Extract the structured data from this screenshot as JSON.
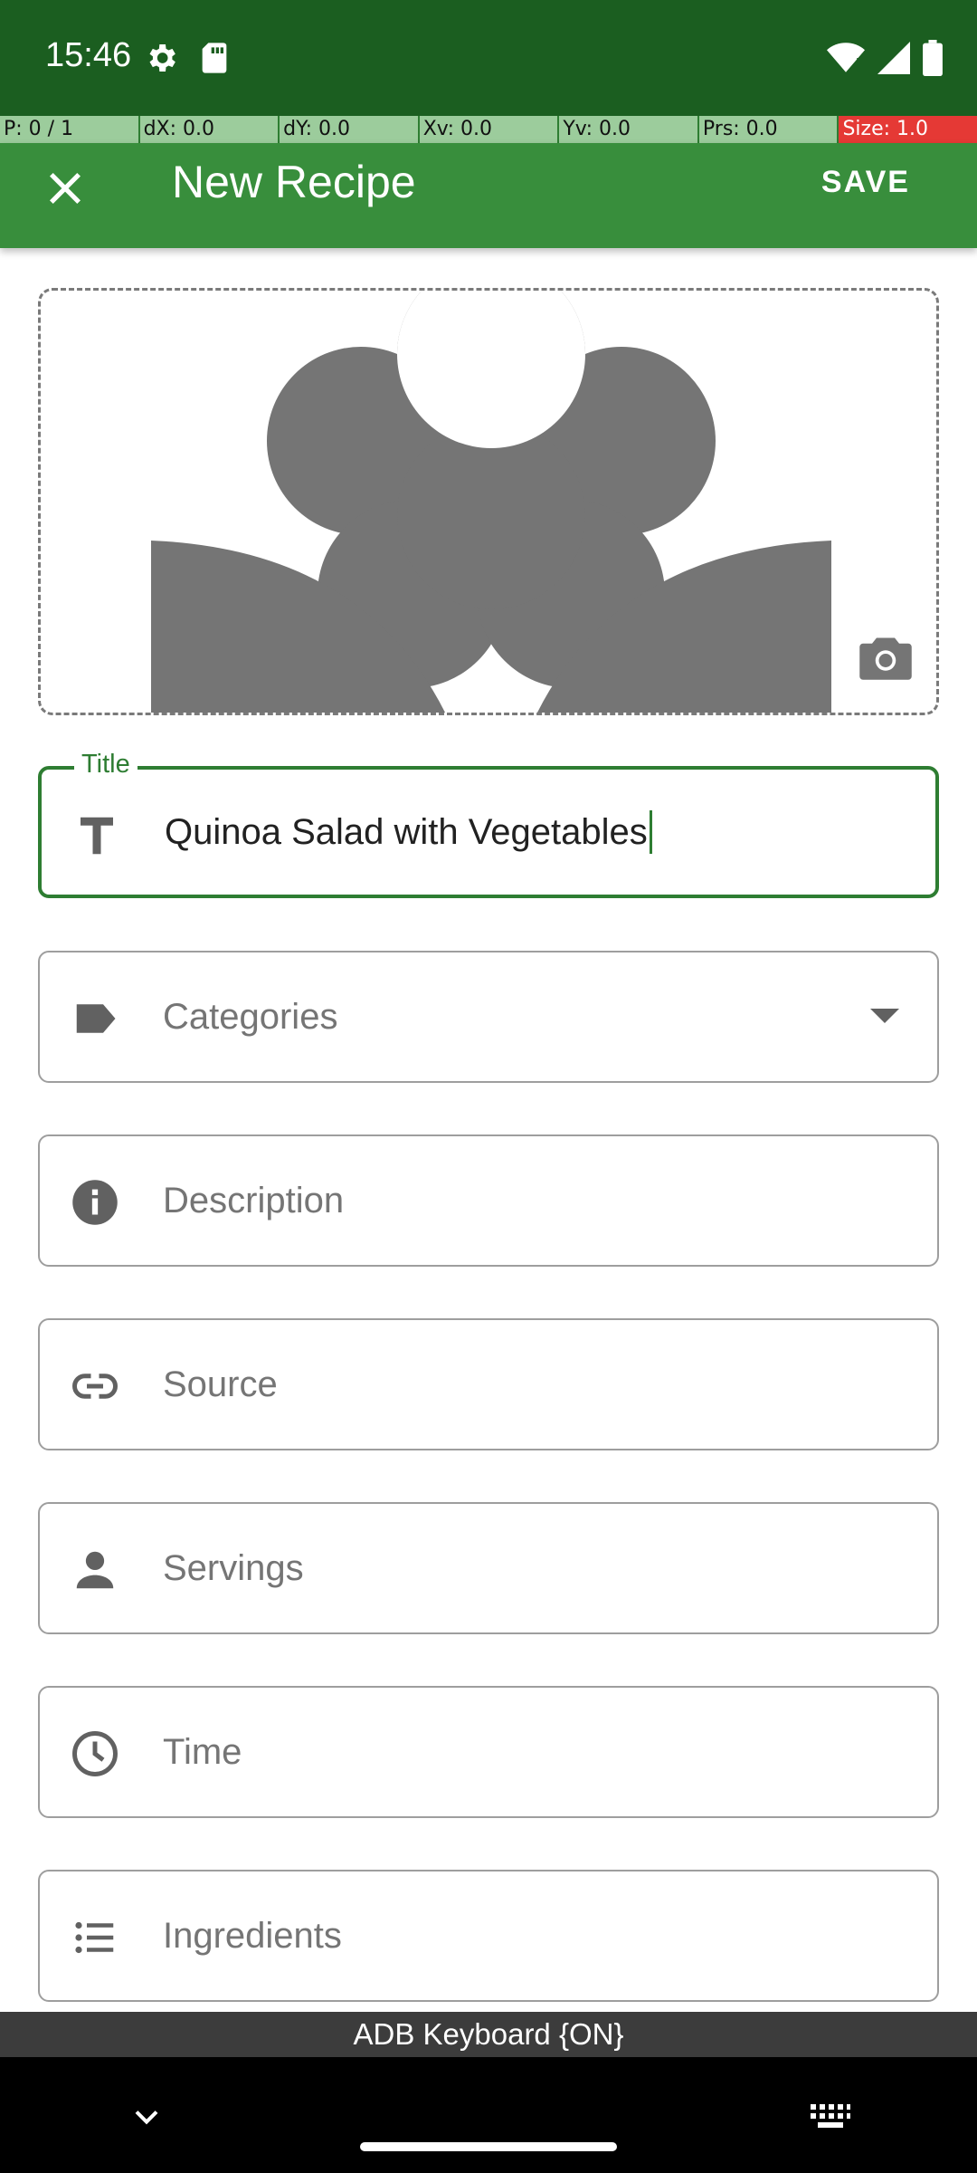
{
  "status_bar": {
    "time": "15:46",
    "icons": [
      "settings-icon",
      "sd-card-icon",
      "wifi-icon",
      "signal-icon",
      "battery-icon"
    ]
  },
  "pointer_overlay": {
    "p": "P: 0 / 1",
    "dx": "dX: 0.0",
    "dy": "dY: 0.0",
    "xv": "Xv: 0.0",
    "yv": "Yv: 0.0",
    "prs": "Prs: 0.0",
    "size": "Size: 1.0"
  },
  "app_bar": {
    "title": "New Recipe",
    "save_label": "SAVE",
    "close_icon": "close-icon"
  },
  "image_area": {
    "placeholder_icon": "flower-placeholder-icon",
    "camera_icon": "camera-icon"
  },
  "form": {
    "title_field": {
      "label": "Title",
      "value": "Quinoa Salad with Vegetables",
      "icon": "text-format-icon"
    },
    "categories_field": {
      "placeholder": "Categories",
      "icon": "label-icon"
    },
    "description_field": {
      "placeholder": "Description",
      "icon": "info-icon"
    },
    "source_field": {
      "placeholder": "Source",
      "icon": "link-icon"
    },
    "servings_field": {
      "placeholder": "Servings",
      "icon": "person-icon"
    },
    "time_field": {
      "placeholder": "Time",
      "icon": "clock-icon"
    },
    "ingredients_field": {
      "placeholder": "Ingredients",
      "icon": "list-icon"
    }
  },
  "keyboard_bar": {
    "label": "ADB Keyboard {ON}"
  },
  "colors": {
    "status_bar": "#1b5e20",
    "app_bar": "#388e3c",
    "accent": "#2e7d32"
  }
}
